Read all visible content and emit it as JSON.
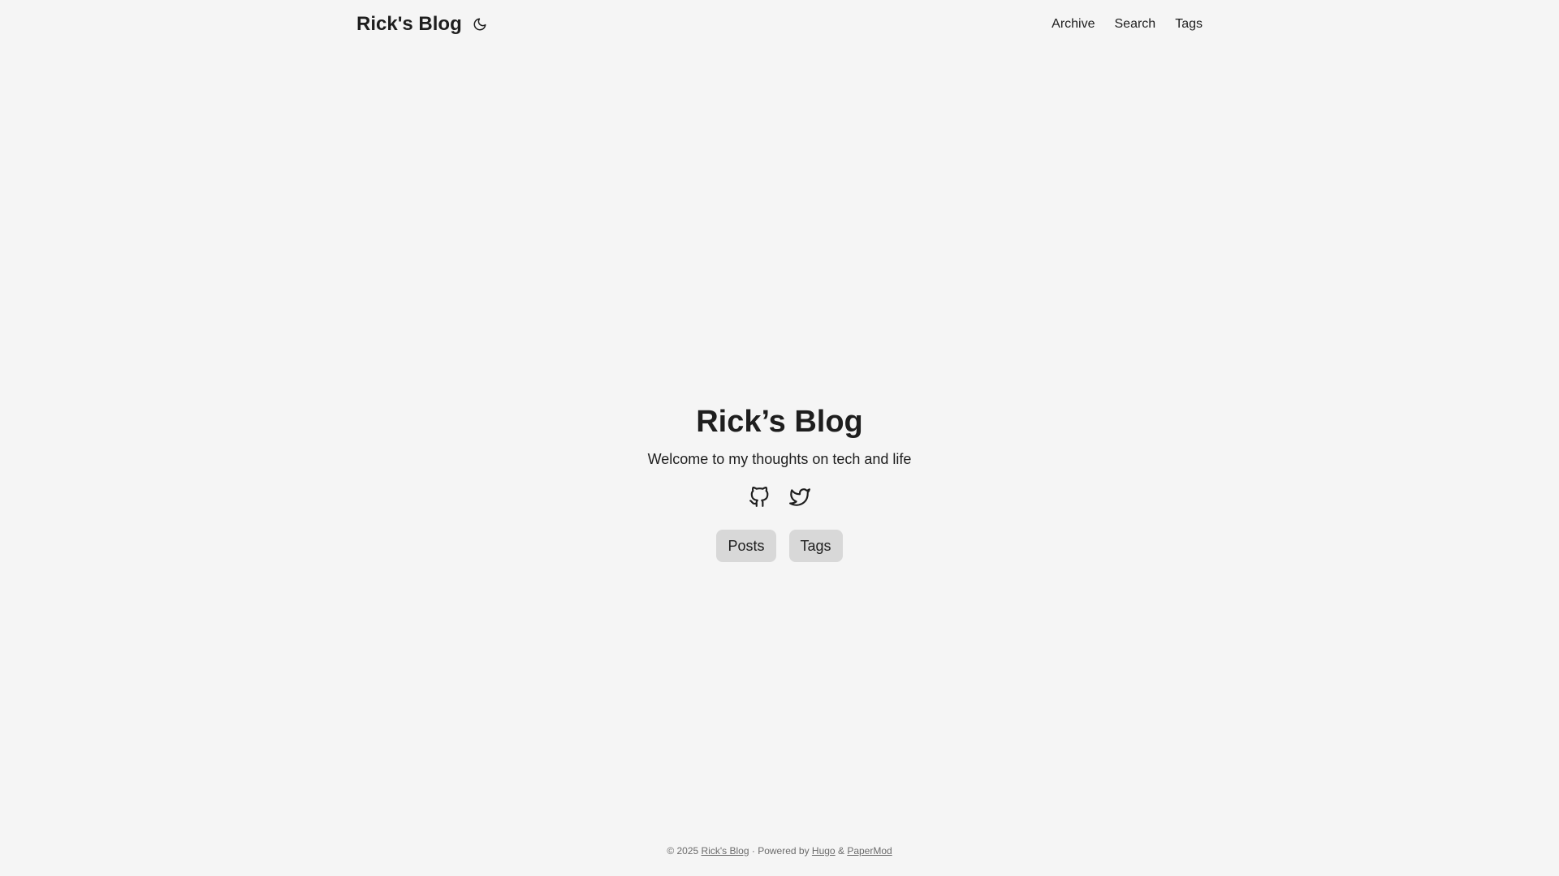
{
  "header": {
    "logo": "Rick's Blog",
    "theme_toggle_icon": "moon-icon",
    "nav": [
      {
        "label": "Archive"
      },
      {
        "label": "Search"
      },
      {
        "label": "Tags"
      }
    ]
  },
  "hero": {
    "title": "Rick’s Blog",
    "subtitle": "Welcome to my thoughts on tech and life",
    "social": [
      {
        "icon": "github-icon"
      },
      {
        "icon": "twitter-icon"
      }
    ],
    "buttons": [
      {
        "label": "Posts"
      },
      {
        "label": "Tags"
      }
    ]
  },
  "footer": {
    "copyright": "© 2025",
    "site_link": "Rick's Blog",
    "separator": "·",
    "powered_by": "Powered by",
    "hugo_link": "Hugo",
    "amp": "&",
    "papermod_link": "PaperMod"
  },
  "colors": {
    "background": "#f5f5f5",
    "text": "#1e1e1e",
    "button_bg": "#d8d8d8",
    "footer_text": "#6b6b6b"
  }
}
